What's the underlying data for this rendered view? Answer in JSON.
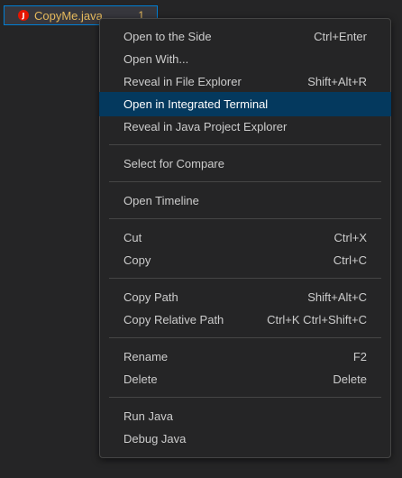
{
  "explorer": {
    "file_name": "CopyMe.java",
    "file_badge": "1",
    "file_icon_glyph": "J"
  },
  "colors": {
    "accent_border": "#007fd4",
    "active_item": "#04395e",
    "modified_file": "#e5b95c",
    "error_icon": "#e51400"
  },
  "context_menu": {
    "groups": [
      [
        {
          "label": "Open to the Side",
          "shortcut": "Ctrl+Enter"
        },
        {
          "label": "Open With...",
          "shortcut": ""
        },
        {
          "label": "Reveal in File Explorer",
          "shortcut": "Shift+Alt+R"
        },
        {
          "label": "Open in Integrated Terminal",
          "shortcut": "",
          "active": true
        },
        {
          "label": "Reveal in Java Project Explorer",
          "shortcut": ""
        }
      ],
      [
        {
          "label": "Select for Compare",
          "shortcut": ""
        }
      ],
      [
        {
          "label": "Open Timeline",
          "shortcut": ""
        }
      ],
      [
        {
          "label": "Cut",
          "shortcut": "Ctrl+X"
        },
        {
          "label": "Copy",
          "shortcut": "Ctrl+C"
        }
      ],
      [
        {
          "label": "Copy Path",
          "shortcut": "Shift+Alt+C"
        },
        {
          "label": "Copy Relative Path",
          "shortcut": "Ctrl+K Ctrl+Shift+C"
        }
      ],
      [
        {
          "label": "Rename",
          "shortcut": "F2"
        },
        {
          "label": "Delete",
          "shortcut": "Delete"
        }
      ],
      [
        {
          "label": "Run Java",
          "shortcut": ""
        },
        {
          "label": "Debug Java",
          "shortcut": ""
        }
      ]
    ]
  }
}
